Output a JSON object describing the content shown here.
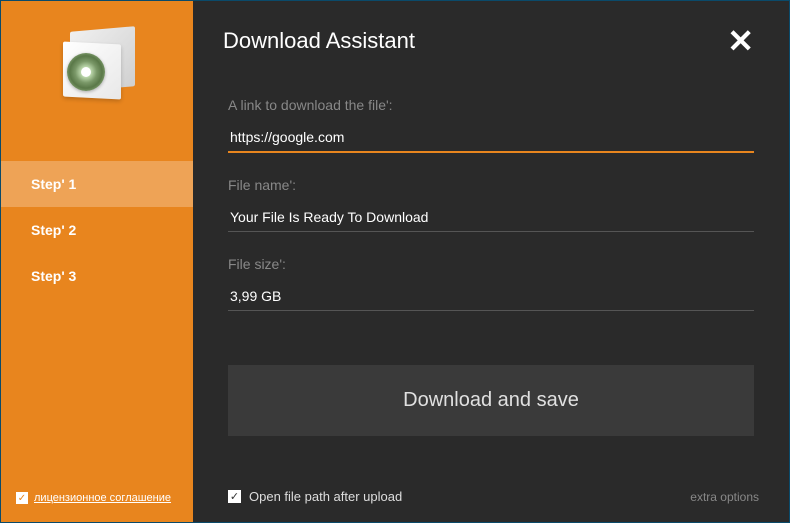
{
  "header": {
    "title": "Download Assistant"
  },
  "sidebar": {
    "steps": [
      {
        "label": "Step' 1",
        "active": true
      },
      {
        "label": "Step' 2",
        "active": false
      },
      {
        "label": "Step' 3",
        "active": false
      }
    ],
    "license": {
      "checked": true,
      "label": "лицензионное соглашение"
    }
  },
  "form": {
    "link": {
      "label": "A link to download the file':",
      "value": "https://google.com"
    },
    "filename": {
      "label": "File name':",
      "value": "Your File Is Ready To Download"
    },
    "filesize": {
      "label": "File size':",
      "value": "3,99 GB"
    },
    "download_button": "Download and save"
  },
  "footer": {
    "open_path": {
      "checked": true,
      "label": "Open file path after upload"
    },
    "extra_options": "extra options"
  },
  "colors": {
    "accent": "#e8851e",
    "background_dark": "#2a2a2a",
    "button_bg": "#3a3a3a"
  }
}
